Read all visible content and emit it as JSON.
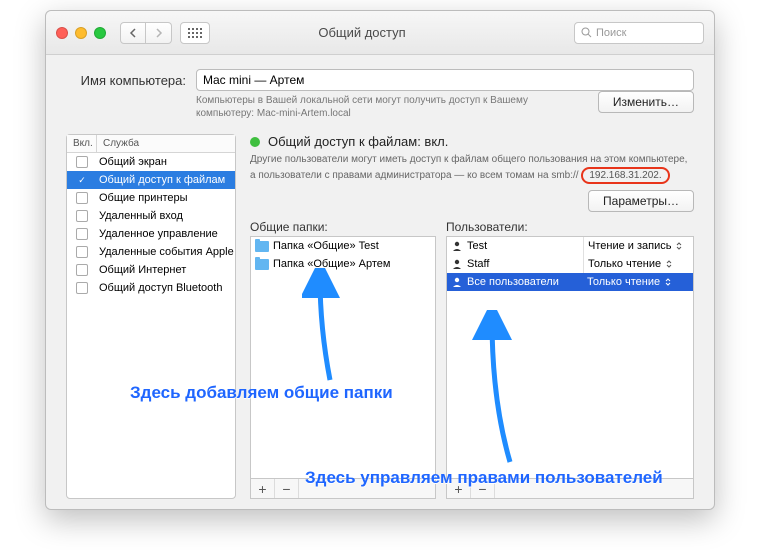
{
  "titlebar": {
    "title": "Общий доступ",
    "search_placeholder": "Поиск"
  },
  "computer_name": {
    "label": "Имя компьютера:",
    "value": "Mac mini — Артем",
    "hint": "Компьютеры в Вашей локальной сети могут получить доступ к Вашему компьютеру: Mac-mini-Artem.local",
    "edit_button": "Изменить…"
  },
  "services": {
    "head_on": "Вкл.",
    "head_name": "Служба",
    "items": [
      {
        "name": "Общий экран",
        "on": false,
        "selected": false
      },
      {
        "name": "Общий доступ к файлам",
        "on": true,
        "selected": true
      },
      {
        "name": "Общие принтеры",
        "on": false,
        "selected": false
      },
      {
        "name": "Удаленный вход",
        "on": false,
        "selected": false
      },
      {
        "name": "Удаленное управление",
        "on": false,
        "selected": false
      },
      {
        "name": "Удаленные события Apple",
        "on": false,
        "selected": false
      },
      {
        "name": "Общий Интернет",
        "on": false,
        "selected": false
      },
      {
        "name": "Общий доступ Bluetooth",
        "on": false,
        "selected": false
      }
    ]
  },
  "status": {
    "title": "Общий доступ к файлам: вкл.",
    "desc": "Другие пользователи могут иметь доступ к файлам общего пользования на этом компьютере, а пользователи с правами администратора — ко всем томам на smb://",
    "ip": "192.168.31.202.",
    "options_button": "Параметры…"
  },
  "folders": {
    "label": "Общие папки:",
    "items": [
      {
        "name": "Папка «Общие» Test"
      },
      {
        "name": "Папка «Общие» Артем"
      }
    ]
  },
  "users": {
    "label": "Пользователи:",
    "items": [
      {
        "name": "Test",
        "perm": "Чтение и запись",
        "selected": false
      },
      {
        "name": "Staff",
        "perm": "Только чтение",
        "selected": false
      },
      {
        "name": "Все пользователи",
        "perm": "Только чтение",
        "selected": true
      }
    ]
  },
  "controls": {
    "add": "+",
    "remove": "−"
  },
  "annotations": {
    "a1": "Здесь добавляем общие папки",
    "a2": "Здесь управляем правами пользователей"
  }
}
